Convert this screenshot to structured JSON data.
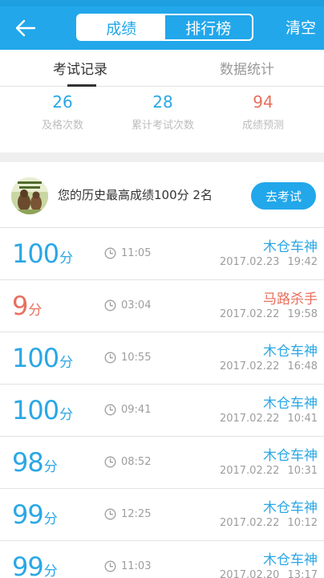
{
  "header": {
    "back_icon": "arrow-left-icon",
    "tabs": [
      {
        "label": "成绩",
        "active": true
      },
      {
        "label": "排行榜",
        "active": false
      }
    ],
    "clear_label": "清空",
    "accent": "#22a7ea"
  },
  "subtabs": [
    {
      "label": "考试记录",
      "active": true
    },
    {
      "label": "数据统计",
      "active": false
    }
  ],
  "stats": [
    {
      "value": "26",
      "label": "及格次数",
      "color": "#2aa7e5"
    },
    {
      "value": "28",
      "label": "累计考试次数",
      "color": "#2aa7e5"
    },
    {
      "value": "94",
      "label": "成绩预测",
      "color": "#e86f5e"
    }
  ],
  "best": {
    "text": "您的历史最高成绩100分  2名",
    "button": "去考试"
  },
  "records": [
    {
      "score": "100",
      "unit": "分",
      "duration": "11:05",
      "title": "木仓车神",
      "date": "2017.02.23 19:42",
      "pass": true
    },
    {
      "score": "9",
      "unit": "分",
      "duration": "03:04",
      "title": "马路杀手",
      "date": "2017.02.22 19:58",
      "pass": false
    },
    {
      "score": "100",
      "unit": "分",
      "duration": "10:55",
      "title": "木仓车神",
      "date": "2017.02.22 16:48",
      "pass": true
    },
    {
      "score": "100",
      "unit": "分",
      "duration": "09:41",
      "title": "木仓车神",
      "date": "2017.02.22 10:41",
      "pass": true
    },
    {
      "score": "98",
      "unit": "分",
      "duration": "08:52",
      "title": "木仓车神",
      "date": "2017.02.22 10:31",
      "pass": true
    },
    {
      "score": "99",
      "unit": "分",
      "duration": "12:25",
      "title": "木仓车神",
      "date": "2017.02.22 10:12",
      "pass": true
    },
    {
      "score": "99",
      "unit": "分",
      "duration": "11:03",
      "title": "木仓车神",
      "date": "2017.02.20 13:17",
      "pass": true
    }
  ]
}
